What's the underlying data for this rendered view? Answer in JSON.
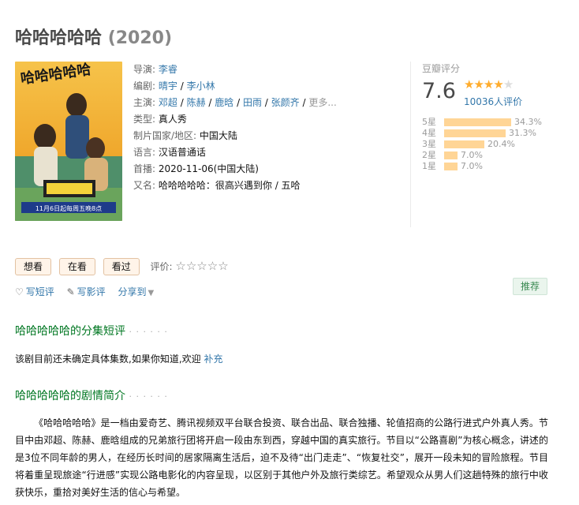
{
  "title": {
    "name": "哈哈哈哈哈",
    "year": "(2020)"
  },
  "info": {
    "director_label": "导演:",
    "directors": [
      "李睿"
    ],
    "writer_label": "编剧:",
    "writers": [
      "晴宇",
      "李小林"
    ],
    "cast_label": "主演:",
    "cast": [
      "邓超",
      "陈赫",
      "鹿晗",
      "田雨",
      "张颜齐"
    ],
    "cast_more": "更多...",
    "genre_label": "类型:",
    "genre": "真人秀",
    "country_label": "制片国家/地区:",
    "country": "中国大陆",
    "language_label": "语言:",
    "language": "汉语普通话",
    "premiere_label": "首播:",
    "premiere": "2020-11-06(中国大陆)",
    "aka_label": "又名:",
    "aka": "哈哈哈哈哈：很高兴遇到你 / 五哈"
  },
  "poster": {
    "title_art": "哈哈哈哈哈",
    "caption": "11月6日起每周五晚8点"
  },
  "rating": {
    "label": "豆瓣评分",
    "score": "7.6",
    "stars_filled": 4,
    "stars_total": 5,
    "votes": "10036人评价",
    "breakdown": [
      {
        "label": "5星",
        "pct": "34.3%",
        "value": 34.3
      },
      {
        "label": "4星",
        "pct": "31.3%",
        "value": 31.3
      },
      {
        "label": "3星",
        "pct": "20.4%",
        "value": 20.4
      },
      {
        "label": "2星",
        "pct": "7.0%",
        "value": 7.0
      },
      {
        "label": "1星",
        "pct": "7.0%",
        "value": 7.0
      }
    ]
  },
  "actions": {
    "want": "想看",
    "watching": "在看",
    "watched": "看过",
    "rate_label": "评价:",
    "rate_stars": "☆☆☆☆☆"
  },
  "subactions": {
    "short_review": "写短评",
    "review": "写影评",
    "share": "分享到",
    "recommend": "推荐"
  },
  "episodes": {
    "title": "哈哈哈哈哈的分集短评",
    "dots": "· · · · · ·",
    "text": "该剧目前还未确定具体集数,如果你知道,欢迎",
    "link": "补充"
  },
  "synopsis": {
    "title": "哈哈哈哈哈的剧情简介",
    "dots": "· · · · · ·",
    "text": "《哈哈哈哈哈》是一档由爱奇艺、腾讯视频双平台联合投资、联合出品、联合独播、轮值招商的公路行进式户外真人秀。节目中由邓超、陈赫、鹿晗组成的兄弟旅行团将开启一段由东到西，穿越中国的真实旅行。节目以“公路喜剧”为核心概念，讲述的是3位不同年龄的男人，在经历长时间的居家隔离生活后，迫不及待“出门走走”、“恢复社交”，展开一段未知的冒险旅程。节目将着重呈现旅途“行进感”实现公路电影化的内容呈现，以区别于其他户外及旅行类综艺。希望观众从男人们这趟特殊的旅行中收获快乐，重拾对美好生活的信心与希望。"
  },
  "colors": {
    "link": "#3377aa",
    "section_green": "#007722",
    "star_on": "#ffac2d",
    "bar": "#ffd596"
  }
}
